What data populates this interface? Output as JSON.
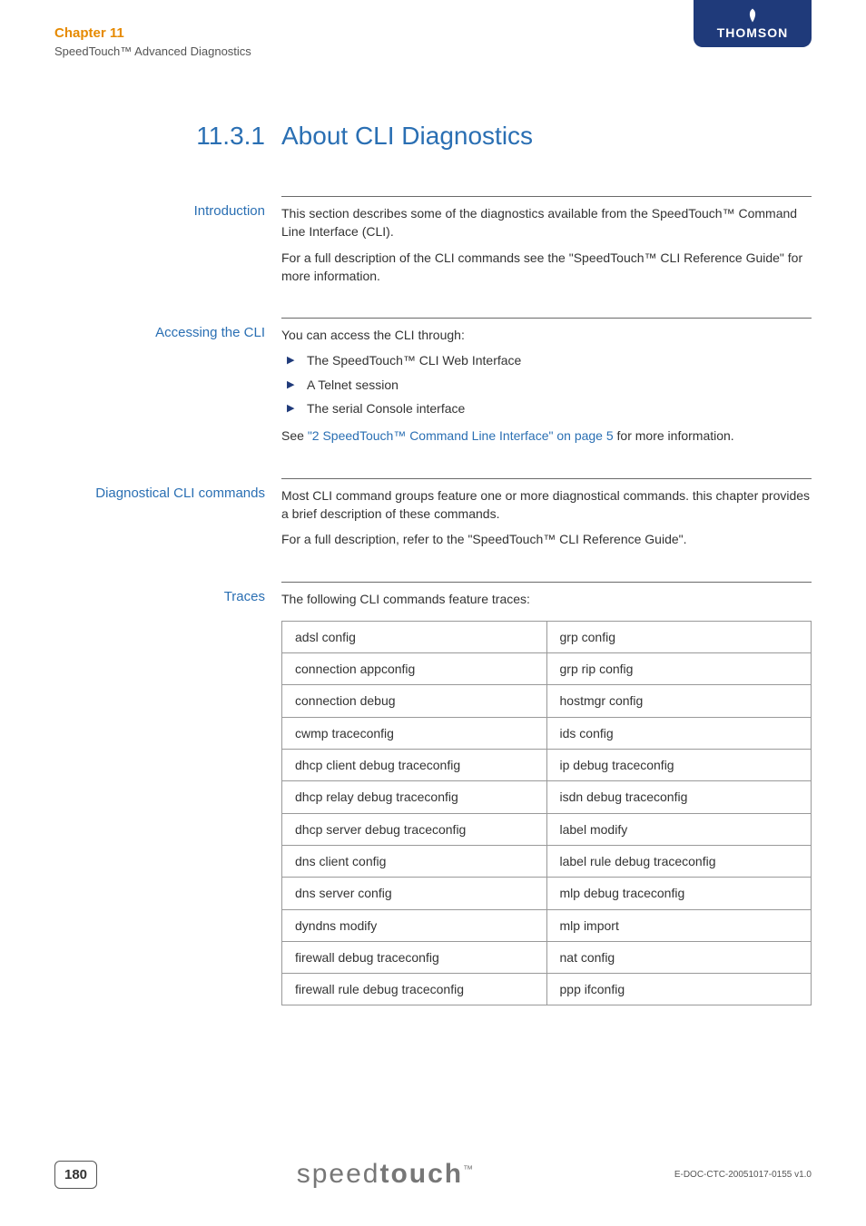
{
  "header": {
    "chapter": "Chapter 11",
    "subtitle": "SpeedTouch™ Advanced Diagnostics",
    "brand": "THOMSON"
  },
  "title": {
    "number": "11.3.1",
    "text": "About CLI Diagnostics"
  },
  "sections": {
    "intro": {
      "label": "Introduction",
      "p1": "This section describes some of the diagnostics available from the SpeedTouch™ Command Line Interface (CLI).",
      "p2_a": "For a full description of the CLI commands see the ",
      "p2_q": "\"SpeedTouch™ CLI Reference Guide\"",
      "p2_b": " for more information."
    },
    "access": {
      "label": "Accessing the CLI",
      "lead": "You can access the CLI through:",
      "items": [
        "The SpeedTouch™ CLI Web Interface",
        "A Telnet session",
        "The serial Console interface"
      ],
      "tail_a": "See ",
      "tail_link": "\"2 SpeedTouch™ Command Line Interface\" on page 5",
      "tail_b": " for more information."
    },
    "diag": {
      "label": "Diagnostical CLI commands",
      "p1": "Most CLI command groups feature one or more diagnostical commands. this chapter provides a brief description of these commands.",
      "p2_a": "For a full description, refer to the ",
      "p2_q": "\"SpeedTouch™ CLI Reference Guide\"",
      "p2_b": "."
    },
    "traces": {
      "label": "Traces",
      "lead": "The following CLI commands feature traces:",
      "rows": [
        [
          "adsl config",
          "grp config"
        ],
        [
          "connection appconfig",
          "grp rip config"
        ],
        [
          "connection debug",
          "hostmgr config"
        ],
        [
          "cwmp traceconfig",
          "ids config"
        ],
        [
          "dhcp client debug traceconfig",
          "ip debug traceconfig"
        ],
        [
          "dhcp relay debug traceconfig",
          "isdn debug traceconfig"
        ],
        [
          "dhcp server debug traceconfig",
          "label modify"
        ],
        [
          "dns client config",
          "label rule debug traceconfig"
        ],
        [
          "dns server config",
          "mlp debug traceconfig"
        ],
        [
          "dyndns modify",
          "mlp import"
        ],
        [
          "firewall debug traceconfig",
          "nat config"
        ],
        [
          "firewall rule debug traceconfig",
          "ppp ifconfig"
        ]
      ]
    }
  },
  "footer": {
    "page": "180",
    "logo_thin": "speed",
    "logo_bold": "touch",
    "logo_tm": "™",
    "docid": "E-DOC-CTC-20051017-0155 v1.0"
  }
}
